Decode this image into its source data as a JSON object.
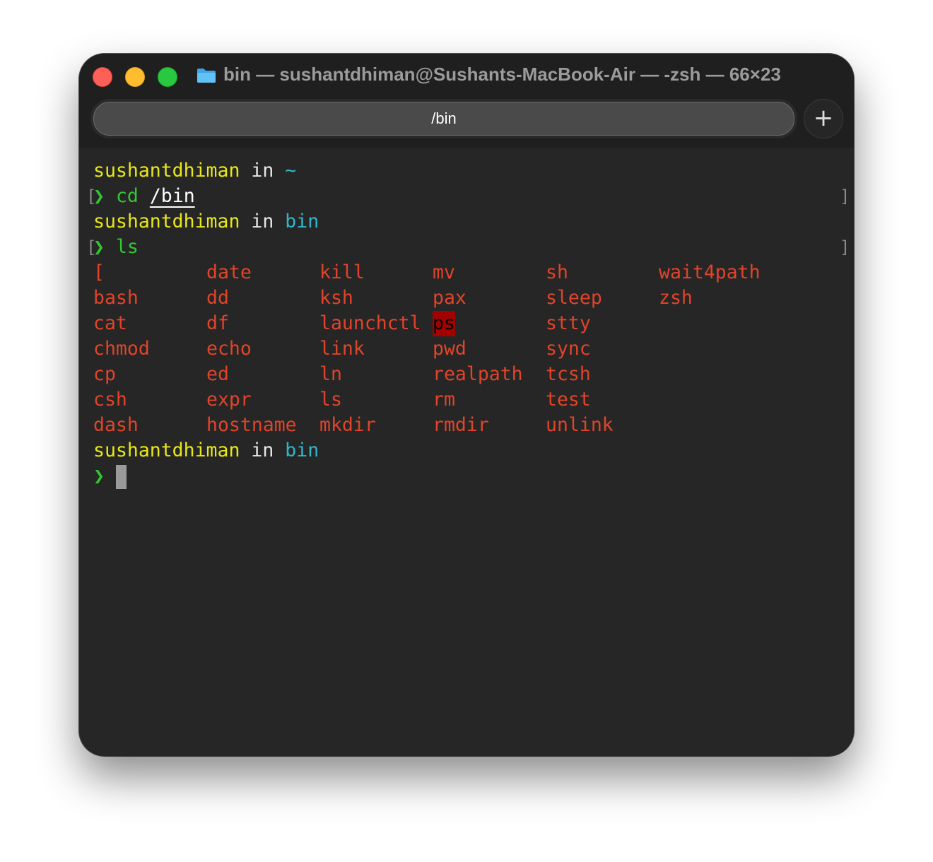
{
  "window": {
    "title": "bin — sushantdhiman@Sushants-MacBook-Air — -zsh — 66×23",
    "tab_label": "/bin",
    "new_tab": "+"
  },
  "terminal": {
    "prompt1": {
      "user": "sushantdhiman",
      "in": "in",
      "dir": "~"
    },
    "cmd1": {
      "arrow": "❯",
      "cmd": "cd",
      "arg": "/bin"
    },
    "prompt2": {
      "user": "sushantdhiman",
      "in": "in",
      "dir": "bin"
    },
    "cmd2": {
      "arrow": "❯",
      "cmd": "ls"
    },
    "ls_rows": [
      [
        "[",
        "date",
        "kill",
        "mv",
        "sh",
        "wait4path"
      ],
      [
        "bash",
        "dd",
        "ksh",
        "pax",
        "sleep",
        "zsh"
      ],
      [
        "cat",
        "df",
        "launchctl",
        "ps",
        "stty",
        ""
      ],
      [
        "chmod",
        "echo",
        "link",
        "pwd",
        "sync",
        ""
      ],
      [
        "cp",
        "ed",
        "ln",
        "realpath",
        "tcsh",
        ""
      ],
      [
        "csh",
        "expr",
        "ls",
        "rm",
        "test",
        ""
      ],
      [
        "dash",
        "hostname",
        "mkdir",
        "rmdir",
        "unlink",
        ""
      ]
    ],
    "highlighted": "ps",
    "prompt3": {
      "user": "sushantdhiman",
      "in": "in",
      "dir": "bin"
    },
    "cmd3": {
      "arrow": "❯"
    },
    "bracket_open": "[",
    "bracket_close": "]"
  }
}
